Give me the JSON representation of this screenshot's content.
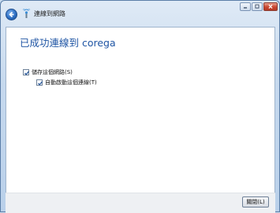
{
  "window": {
    "title": "連線到網路"
  },
  "content": {
    "heading": "已成功連線到 corega",
    "save_network": {
      "label": "儲存這個網路(S)",
      "checked": true
    },
    "auto_connect": {
      "label": "自動啟動這個連線(T)",
      "checked": true
    }
  },
  "footer": {
    "close_label": "關閉(L)"
  },
  "colors": {
    "heading": "#1f55a4",
    "close_button_red": "#c8452f"
  }
}
